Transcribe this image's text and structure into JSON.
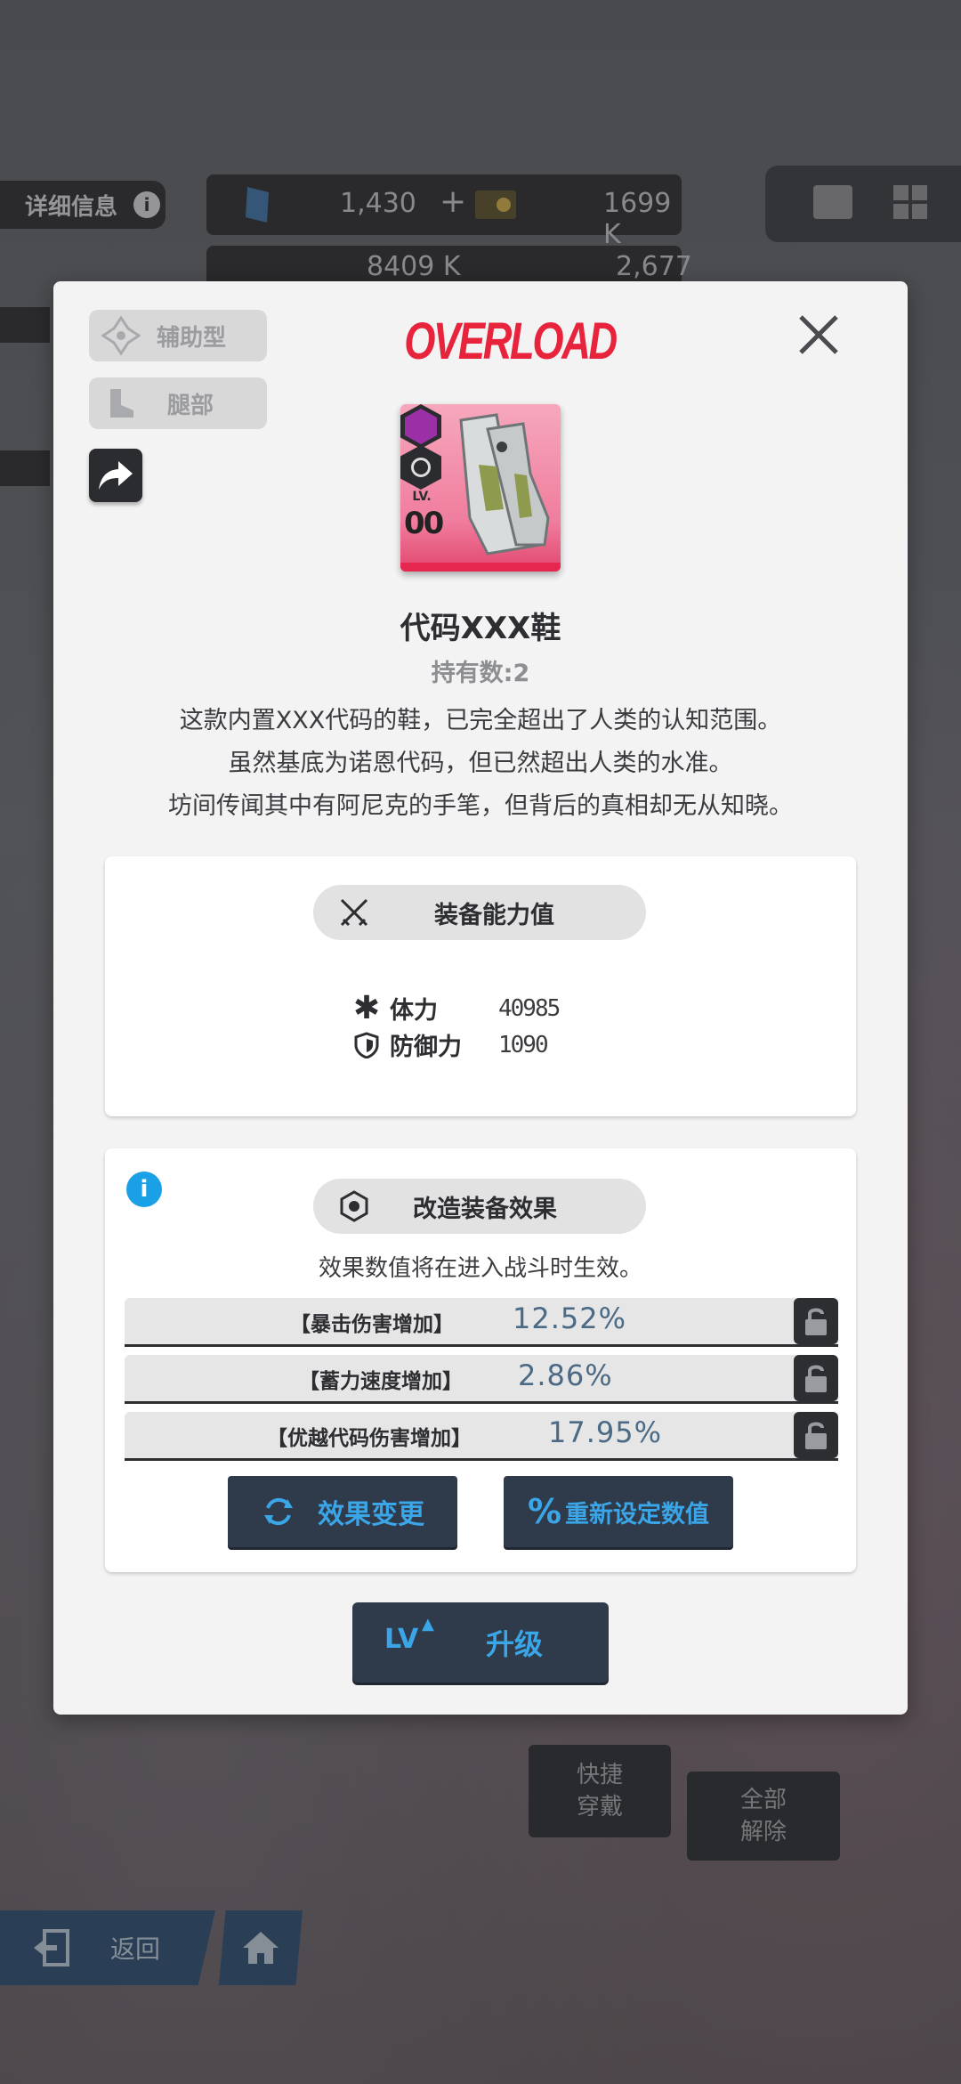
{
  "hud": {
    "detail_label": "详细信息",
    "currency1_value": "1,430",
    "currency2_value": "1699 K",
    "currency3_value": "8409 K",
    "currency4_value": "2,677"
  },
  "background": {
    "quick_equip_label": "快捷\n穿戴",
    "unequip_all_label": "全部\n解除",
    "back_label": "返回"
  },
  "modal": {
    "type_tag": "辅助型",
    "slot_tag": "腿部",
    "logo_text": "OVERLOAD",
    "item": {
      "lv_label": "LV.",
      "lv_value": "00",
      "name": "代码XXX鞋",
      "owned_label": "持有数:",
      "owned_count": "2"
    },
    "description": [
      "这款内置XXX代码的鞋，已完全超出了人类的认知范围。",
      "虽然基底为诺恩代码，但已然超出人类的水准。",
      "坊间传闻其中有阿尼克的手笔，但背后的真相却无从知晓。"
    ],
    "stats_panel": {
      "title": "装备能力值",
      "stats": [
        {
          "label": "体力",
          "value": "40985",
          "icon": "asterisk-icon"
        },
        {
          "label": "防御力",
          "value": "1090",
          "icon": "shield-icon"
        }
      ]
    },
    "effects_panel": {
      "title": "改造装备效果",
      "note": "效果数值将在进入战斗时生效。",
      "effects": [
        {
          "name": "【暴击伤害增加】",
          "value": "12.52%"
        },
        {
          "name": "【蓄力速度增加】",
          "value": "2.86%"
        },
        {
          "name": "【优越代码伤害增加】",
          "value": "17.95%"
        }
      ],
      "change_button": "效果变更",
      "reset_button": "重新设定数值"
    },
    "upgrade_button": {
      "lv_text": "LV",
      "label": "升级"
    }
  },
  "colors": {
    "accent_blue": "#3aa6e8",
    "logo_red": "#e8233c",
    "button_dark": "#2f3a4a",
    "info_blue": "#1aa0e6"
  }
}
